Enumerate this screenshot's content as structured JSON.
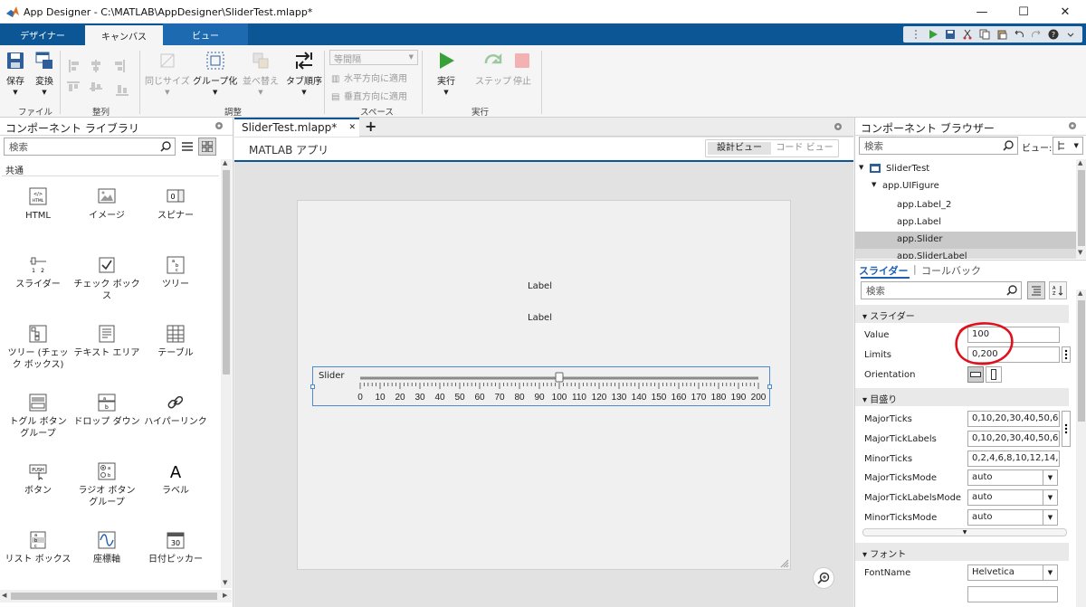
{
  "window": {
    "title": "App Designer - C:\\MATLAB\\AppDesigner\\SliderTest.mlapp*",
    "minimize": "—",
    "maximize": "☐",
    "close": "✕"
  },
  "ribbon_tabs": [
    "デザイナー",
    "キャンバス",
    "ビュー"
  ],
  "ribbon": {
    "save": "保存",
    "convert": "変換",
    "file_section": "ファイル",
    "align_section": "整列",
    "same_size": "同じサイズ",
    "group": "グループ化",
    "reorder": "並べ替え",
    "tab_order": "タブ順序",
    "arrange_section": "調整",
    "spacing_dropdown": "等間隔",
    "apply_h": "水平方向に適用",
    "apply_v": "垂直方向に適用",
    "space_section": "スペース",
    "run": "実行",
    "step": "ステップ",
    "stop": "停止",
    "run_section": "実行"
  },
  "library": {
    "title": "コンポーネント ライブラリ",
    "search_placeholder": "検索",
    "group": "共通",
    "items": [
      {
        "label": "HTML",
        "icon": "html-icon"
      },
      {
        "label": "イメージ",
        "icon": "image-icon"
      },
      {
        "label": "スピナー",
        "icon": "spinner-icon"
      },
      {
        "label": "スライダー",
        "icon": "slider-icon"
      },
      {
        "label": "チェック ボックス",
        "icon": "checkbox-icon"
      },
      {
        "label": "ツリー",
        "icon": "tree-icon"
      },
      {
        "label": "ツリー (チェック ボックス)",
        "icon": "checkbox-tree-icon"
      },
      {
        "label": "テキスト エリア",
        "icon": "text-area-icon"
      },
      {
        "label": "テーブル",
        "icon": "table-icon"
      },
      {
        "label": "トグル ボタン グループ",
        "icon": "toggle-button-group-icon"
      },
      {
        "label": "ドロップ ダウン",
        "icon": "drop-down-icon"
      },
      {
        "label": "ハイパーリンク",
        "icon": "hyperlink-icon"
      },
      {
        "label": "ボタン",
        "icon": "push-button-icon"
      },
      {
        "label": "ラジオ ボタン グループ",
        "icon": "radio-button-group-icon"
      },
      {
        "label": "ラベル",
        "icon": "label-icon"
      },
      {
        "label": "リスト ボックス",
        "icon": "list-box-icon"
      },
      {
        "label": "座標軸",
        "icon": "axes-icon"
      },
      {
        "label": "日付ピッカー",
        "icon": "date-picker-icon"
      }
    ]
  },
  "editor": {
    "doc_tab": "SliderTest.mlapp*",
    "subtitle": "MATLAB アプリ",
    "design_view": "設計ビュー",
    "code_view": "コード ビュー",
    "canvas": {
      "label_2": "Label",
      "label_1": "Label",
      "slider_label": "Slider",
      "slider_value": 100,
      "slider_limits": [
        0,
        200
      ],
      "ticks": [
        "0",
        "10",
        "20",
        "30",
        "40",
        "50",
        "60",
        "70",
        "80",
        "90",
        "100",
        "110",
        "120",
        "130",
        "140",
        "150",
        "160",
        "170",
        "180",
        "190",
        "200"
      ]
    }
  },
  "browser": {
    "title": "コンポーネント ブラウザー",
    "search_placeholder": "検索",
    "view_label": "ビュー:",
    "tree": [
      "SliderTest",
      "app.UIFigure",
      "app.Label_2",
      "app.Label",
      "app.Slider",
      "app.SliderLabel"
    ],
    "selected": "app.Slider",
    "tab_active": "スライダー",
    "tab_other": "コールバック",
    "prop_search_placeholder": "検索",
    "sec_slider": "スライダー",
    "value_label": "Value",
    "value": "100",
    "limits_label": "Limits",
    "limits": "0,200",
    "orientation_label": "Orientation",
    "sec_ticks": "目盛り",
    "major_ticks_label": "MajorTicks",
    "major_ticks": "0,10,20,30,40,50,60",
    "major_tick_labels_label": "MajorTickLabels",
    "major_tick_labels": "0,10,20,30,40,50,60",
    "minor_ticks_label": "MinorTicks",
    "minor_ticks": "0,2,4,6,8,10,12,14,1",
    "major_ticks_mode_label": "MajorTicksMode",
    "major_ticks_mode": "auto",
    "major_tick_labels_mode_label": "MajorTickLabelsMode",
    "major_tick_labels_mode": "auto",
    "minor_ticks_mode_label": "MinorTicksMode",
    "minor_ticks_mode": "auto",
    "sec_font": "フォント",
    "font_name_label": "FontName",
    "font_name": "Helvetica"
  },
  "colors": {
    "ribbon_blue": "#0d5696",
    "selection": "#c9c9c9",
    "annotation_red": "#e0101c",
    "link_blue": "#1f5fb3"
  }
}
